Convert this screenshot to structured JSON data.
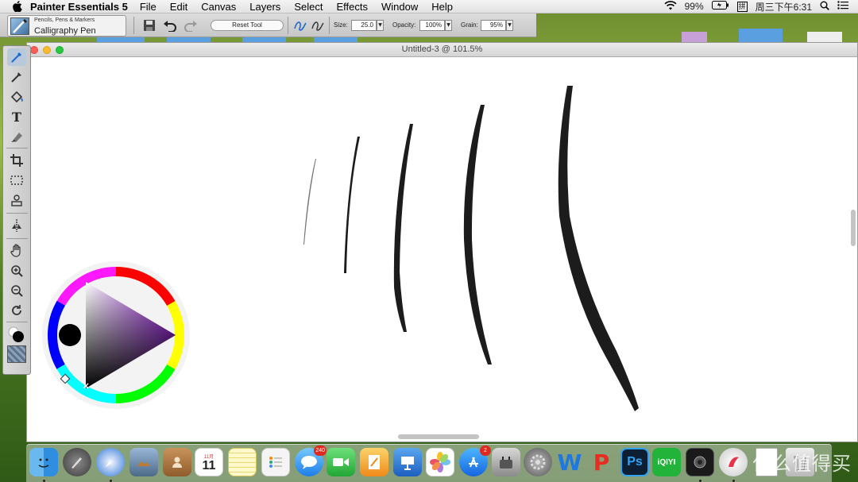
{
  "menubar": {
    "app_name": "Painter Essentials 5",
    "items": [
      "File",
      "Edit",
      "Canvas",
      "Layers",
      "Select",
      "Effects",
      "Window",
      "Help"
    ],
    "battery": "99%",
    "ime": "拼",
    "clock": "周三下午6:31"
  },
  "options_bar": {
    "brush_category": "Pencils, Pens & Markers",
    "brush_variant": "Calligraphy Pen",
    "reset_tool_label": "Reset Tool",
    "size_label": "Size:",
    "size_value": "25.0",
    "opacity_label": "Opacity:",
    "opacity_value": "100%",
    "grain_label": "Grain:",
    "grain_value": "95%"
  },
  "document": {
    "title": "Untitled-3 @ 101.5%"
  },
  "colors": {
    "accent": "#1e6ad0",
    "stroke": "#1c1c1c",
    "current_color": "#000000"
  },
  "dock": {
    "apps": [
      {
        "name": "finder-icon",
        "label": "",
        "running": true
      },
      {
        "name": "launchpad-icon",
        "label": "",
        "running": false
      },
      {
        "name": "safari-icon",
        "label": "",
        "running": true
      },
      {
        "name": "preview-icon",
        "label": "",
        "running": false
      },
      {
        "name": "contacts-icon",
        "label": "",
        "running": false
      },
      {
        "name": "calendar-icon",
        "label": "11",
        "month": "11月",
        "running": false
      },
      {
        "name": "notes-icon",
        "label": "",
        "running": false
      },
      {
        "name": "reminders-icon",
        "label": "",
        "running": false
      },
      {
        "name": "messages-icon",
        "label": "",
        "badge": "240",
        "running": false
      },
      {
        "name": "facetime-icon",
        "label": "",
        "running": false
      },
      {
        "name": "pages-icon",
        "label": "",
        "running": false
      },
      {
        "name": "keynote-icon",
        "label": "",
        "running": false
      },
      {
        "name": "photos-icon",
        "label": "",
        "running": false
      },
      {
        "name": "app-store-icon",
        "label": "",
        "badge": "2",
        "running": false
      },
      {
        "name": "disk-utility-icon",
        "label": "",
        "running": false
      },
      {
        "name": "system-preferences-icon",
        "label": "",
        "running": false
      },
      {
        "name": "wps-writer-icon",
        "label": "W",
        "running": false
      },
      {
        "name": "wps-presentation-icon",
        "label": "P",
        "running": false
      },
      {
        "name": "photoshop-icon",
        "label": "Ps",
        "running": false
      },
      {
        "name": "iqiyi-icon",
        "label": "iQIYI",
        "running": false
      },
      {
        "name": "screen-capture-icon",
        "label": "",
        "running": true
      },
      {
        "name": "painter-icon",
        "label": "",
        "running": true
      },
      {
        "name": "document-icon",
        "label": "",
        "running": false
      },
      {
        "name": "trash-icon",
        "label": "",
        "running": false
      }
    ]
  },
  "watermark": "什么值得买"
}
